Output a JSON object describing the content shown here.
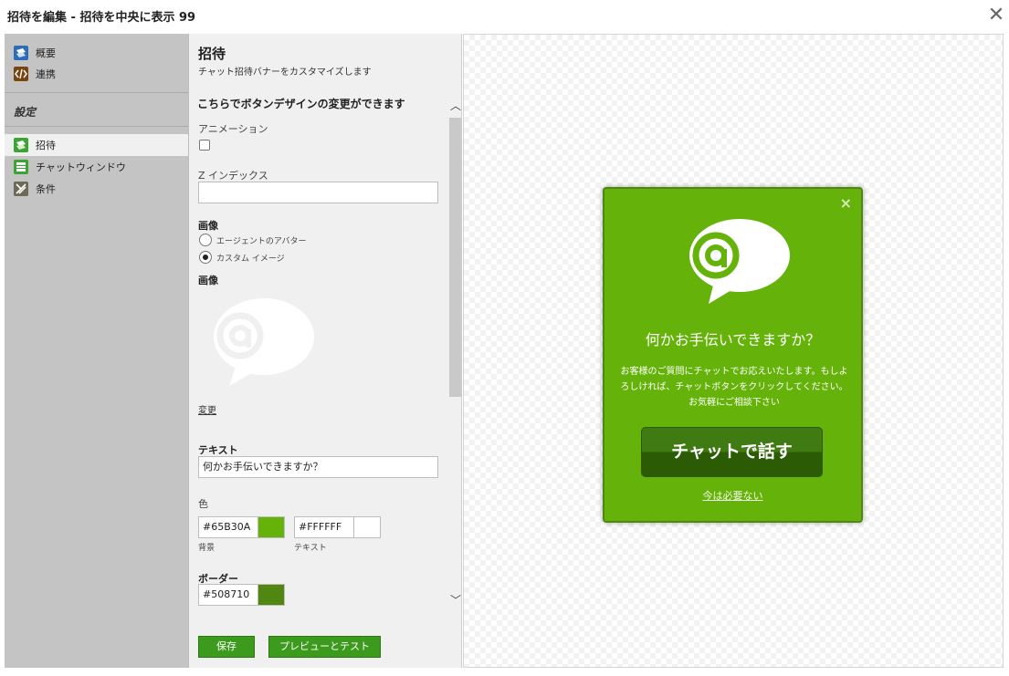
{
  "dialog": {
    "title": "招待を編集 - 招待を中央に表示 99",
    "close_icon": "close-icon"
  },
  "sidebar": {
    "items": [
      {
        "label": "概要",
        "icon": "overview-icon"
      },
      {
        "label": "連携",
        "icon": "code-icon"
      }
    ],
    "section_header": "設定",
    "settings_items": [
      {
        "label": "招待",
        "icon": "invite-icon",
        "active": true
      },
      {
        "label": "チャットウィンドウ",
        "icon": "chat-window-icon"
      },
      {
        "label": "条件",
        "icon": "conditions-icon"
      }
    ]
  },
  "form": {
    "title": "招待",
    "subtitle": "チャット招待バナーをカスタマイズします",
    "heading": "こちらでボタンデザインの変更ができます",
    "animation_label": "アニメーション",
    "animation_checked": false,
    "zindex_label": "Z インデックス",
    "zindex_value": "",
    "image_label": "画像",
    "image_options": [
      "エージェントのアバター",
      "カスタム イメージ"
    ],
    "image_selected": 1,
    "image_preview_label": "画像",
    "change_link": "変更",
    "text_label": "テキスト",
    "text_value": "何かお手伝いできますか？",
    "color_label": "色",
    "bg_color": "#65B30A",
    "bg_caption": "背景",
    "text_color": "#FFFFFF",
    "text_caption": "テキスト",
    "border_label": "ボーダー",
    "border_color": "#508710",
    "save_label": "保存",
    "preview_label": "プレビューとテスト"
  },
  "banner": {
    "headline": "何かお手伝いできますか？",
    "body": "お客様のご質問にチャットでお応えいたします。もしよろしければ、チャットボタンをクリックしてください。お気軽にご相談下さい",
    "button": "チャットで話す",
    "dismiss": "今は必要ない",
    "close": "×"
  }
}
